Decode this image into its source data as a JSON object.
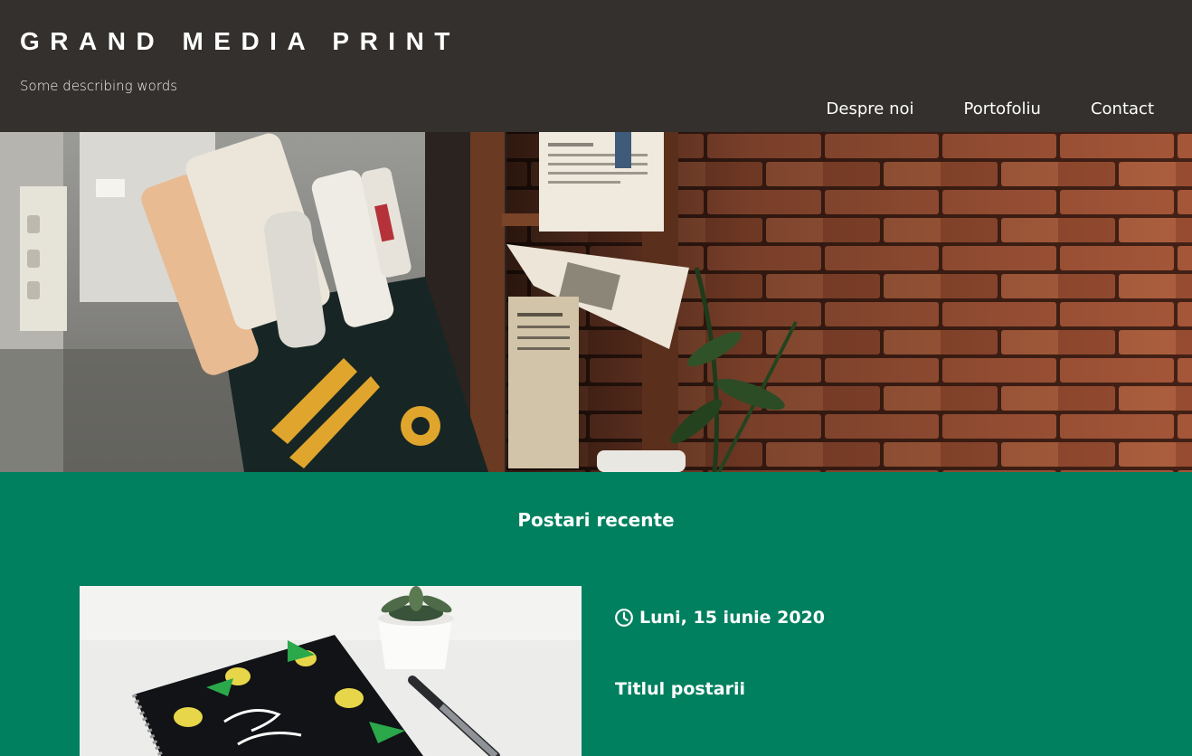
{
  "header": {
    "brand_title": "GRAND MEDIA PRINT",
    "tagline": "Some describing words",
    "nav": [
      "Despre noi",
      "Portofoliu",
      "Contact"
    ]
  },
  "colors": {
    "header_bg": "#33302d",
    "section_bg": "#00805f",
    "text": "#ffffff"
  },
  "recent_posts": {
    "section_title": "Postari recente",
    "posts": [
      {
        "date": "Luni, 15 iunie 2020",
        "title": "Titlul postarii",
        "date_icon": "clock-icon"
      }
    ]
  }
}
